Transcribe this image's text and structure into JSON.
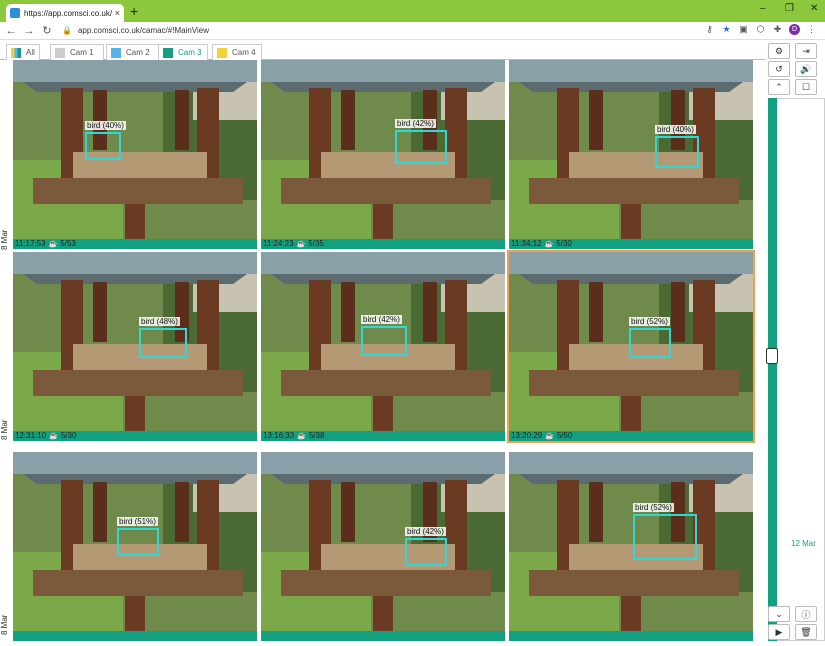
{
  "browser": {
    "tab_title": "https://app.comsci.co.uk/camac",
    "tab_close": "×",
    "new_tab": "+",
    "url": "app.comsci.co.uk/camac/#!MainView",
    "win_minimize": "–",
    "win_maximize": "❐",
    "win_close": "✕",
    "profile_initial": "D"
  },
  "camera_tabs": [
    {
      "label": "All",
      "swatch": "all"
    },
    {
      "label": "Cam 1",
      "swatch": "#cccccc"
    },
    {
      "label": "Cam 2",
      "swatch": "#56b4e9"
    },
    {
      "label": "Cam 3",
      "swatch": "#1a9a7f",
      "active": true
    },
    {
      "label": "Cam 4",
      "swatch": "#f1d23a"
    }
  ],
  "rows": [
    {
      "date_label": "8 Mar"
    },
    {
      "date_label": "8 Mar"
    },
    {
      "date_label": "8 Mar"
    }
  ],
  "cells": [
    {
      "time": "11:17:53",
      "count": "5/53",
      "detection": "bird (40%)"
    },
    {
      "time": "11:24:23",
      "count": "5/35",
      "detection": "bird (42%)"
    },
    {
      "time": "11:34:12",
      "count": "5/30",
      "detection": "bird (40%)"
    },
    {
      "time": "12:31:10",
      "count": "5/30",
      "detection": "bird (48%)"
    },
    {
      "time": "13:16:33",
      "count": "5/38",
      "detection": "bird (42%)"
    },
    {
      "time": "13:20:29",
      "count": "5/50",
      "detection": "bird (52%)",
      "highlighted": true
    },
    {
      "time": "",
      "count": "",
      "detection": "bird (51%)"
    },
    {
      "time": "",
      "count": "",
      "detection": "bird (42%)"
    },
    {
      "time": "",
      "count": "",
      "detection": "bird (52%)"
    }
  ],
  "sidebar": {
    "timeline_date": "12 Mar",
    "icons": [
      "gear-icon",
      "logout-icon",
      "history-icon",
      "volume-icon",
      "chevron-up-icon",
      "stop-icon",
      "chevron-down-icon",
      "info-icon",
      "play-icon",
      "trash-icon"
    ]
  },
  "colors": {
    "brand_green": "#8cc83c",
    "accent_teal": "#13a080",
    "bbox_cyan": "#2fd7d7",
    "highlight_orange": "#f0a050"
  }
}
